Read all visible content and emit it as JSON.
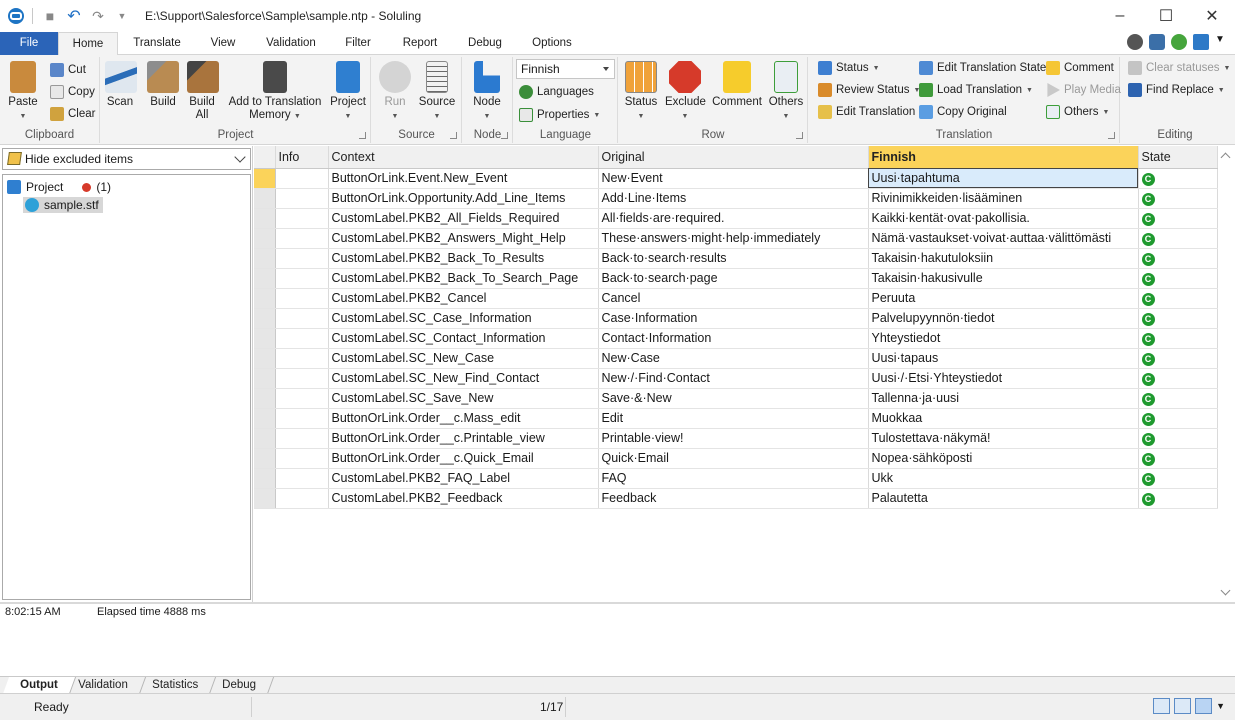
{
  "window": {
    "path": "E:\\Support\\Salesforce\\Sample\\sample.ntp",
    "separator": " - ",
    "app_name": "Soluling"
  },
  "tabs": [
    "File",
    "Home",
    "Translate",
    "View",
    "Validation",
    "Filter",
    "Report",
    "Debug",
    "Options"
  ],
  "active_tab": "Home",
  "ribbon": {
    "clipboard": {
      "label": "Clipboard",
      "paste": "Paste",
      "cut": "Cut",
      "copy": "Copy",
      "clear": "Clear"
    },
    "project": {
      "label": "Project",
      "scan": "Scan",
      "build": "Build",
      "build_all_1": "Build",
      "build_all_2": "All",
      "add_tm_1": "Add to Translation",
      "add_tm_2": "Memory",
      "project": "Project"
    },
    "source": {
      "label": "Source",
      "run": "Run",
      "source": "Source"
    },
    "node": {
      "label": "Node",
      "node": "Node"
    },
    "language": {
      "label": "Language",
      "selected": "Finnish",
      "languages": "Languages",
      "properties": "Properties"
    },
    "row": {
      "label": "Row",
      "status": "Status",
      "exclude": "Exclude",
      "comment": "Comment",
      "others": "Others"
    },
    "translation": {
      "label": "Translation",
      "status": "Status",
      "review_status": "Review Status",
      "edit_translation": "Edit Translation",
      "edit_translation_state": "Edit Translation State",
      "load_translation": "Load Translation",
      "copy_original": "Copy Original",
      "comment": "Comment",
      "play_media": "Play Media",
      "others": "Others"
    },
    "editing": {
      "label": "Editing",
      "clear_statuses": "Clear statuses",
      "find_replace": "Find  Replace"
    }
  },
  "left_pane": {
    "filter": "Hide excluded items",
    "project_label": "Project",
    "project_count": "(1)",
    "file": "sample.stf"
  },
  "grid": {
    "columns": [
      "Info",
      "Context",
      "Original",
      "Finnish",
      "State"
    ],
    "state_glyph": "C",
    "rows": [
      {
        "context": "ButtonOrLink.Event.New_Event",
        "original": "New·Event",
        "finnish": "Uusi·tapahtuma"
      },
      {
        "context": "ButtonOrLink.Opportunity.Add_Line_Items",
        "original": "Add·Line·Items",
        "finnish": "Rivinimikkeiden·lisääminen"
      },
      {
        "context": "CustomLabel.PKB2_All_Fields_Required",
        "original": "All·fields·are·required.",
        "finnish": "Kaikki·kentät·ovat·pakollisia."
      },
      {
        "context": "CustomLabel.PKB2_Answers_Might_Help",
        "original": "These·answers·might·help·immediately",
        "finnish": "Nämä·vastaukset·voivat·auttaa·välittömästi"
      },
      {
        "context": "CustomLabel.PKB2_Back_To_Results",
        "original": "Back·to·search·results",
        "finnish": "Takaisin·hakutuloksiin"
      },
      {
        "context": "CustomLabel.PKB2_Back_To_Search_Page",
        "original": "Back·to·search·page",
        "finnish": "Takaisin·hakusivulle"
      },
      {
        "context": "CustomLabel.PKB2_Cancel",
        "original": "Cancel",
        "finnish": "Peruuta"
      },
      {
        "context": "CustomLabel.SC_Case_Information",
        "original": "Case·Information",
        "finnish": "Palvelupyynnön·tiedot"
      },
      {
        "context": "CustomLabel.SC_Contact_Information",
        "original": "Contact·Information",
        "finnish": "Yhteystiedot"
      },
      {
        "context": "CustomLabel.SC_New_Case",
        "original": "New·Case",
        "finnish": "Uusi·tapaus"
      },
      {
        "context": "CustomLabel.SC_New_Find_Contact",
        "original": "New·/·Find·Contact",
        "finnish": "Uusi·/·Etsi·Yhteystiedot"
      },
      {
        "context": "CustomLabel.SC_Save_New",
        "original": "Save·&·New",
        "finnish": "Tallenna·ja·uusi"
      },
      {
        "context": "ButtonOrLink.Order__c.Mass_edit",
        "original": "Edit",
        "finnish": "Muokkaa"
      },
      {
        "context": "ButtonOrLink.Order__c.Printable_view",
        "original": "Printable·view!",
        "finnish": "Tulostettava·näkymä!"
      },
      {
        "context": "ButtonOrLink.Order__c.Quick_Email",
        "original": "Quick·Email",
        "finnish": "Nopea·sähköposti"
      },
      {
        "context": "CustomLabel.PKB2_FAQ_Label",
        "original": "FAQ",
        "finnish": "Ukk"
      },
      {
        "context": "CustomLabel.PKB2_Feedback",
        "original": "Feedback",
        "finnish": "Palautetta"
      }
    ]
  },
  "output": {
    "time": "8:02:15 AM",
    "message": "Elapsed time 4888 ms"
  },
  "bottom_tabs": [
    "Output",
    "Validation",
    "Statistics",
    "Debug"
  ],
  "status": {
    "ready": "Ready",
    "position": "1/17"
  },
  "colors": {
    "accent": "#2b64b8",
    "highlight": "#fbd35a",
    "ok_state": "#1f9a2f"
  }
}
